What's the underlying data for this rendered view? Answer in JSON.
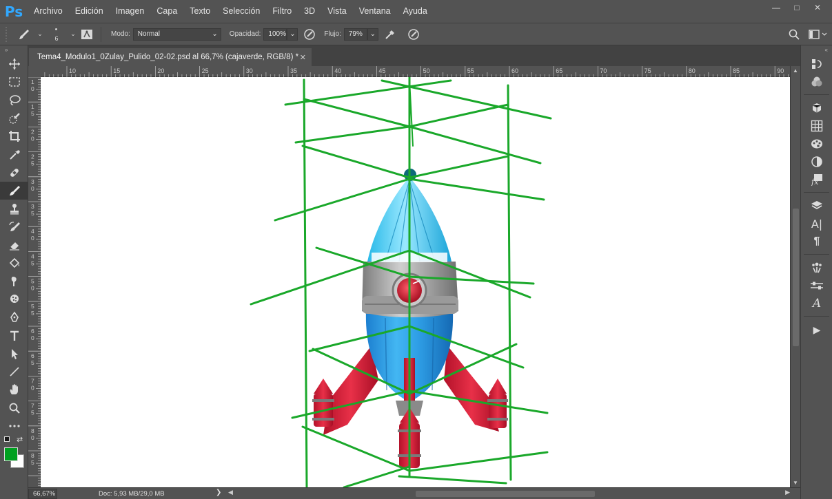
{
  "app": {
    "logo": "Ps"
  },
  "menu": [
    "Archivo",
    "Edición",
    "Imagen",
    "Capa",
    "Texto",
    "Selección",
    "Filtro",
    "3D",
    "Vista",
    "Ventana",
    "Ayuda"
  ],
  "window_controls": {
    "minimize": "—",
    "maximize": "□",
    "close": "✕"
  },
  "options": {
    "brush_size": "6",
    "mode_label": "Modo:",
    "mode_value": "Normal",
    "opacity_label": "Opacidad:",
    "opacity_value": "100%",
    "flow_label": "Flujo:",
    "flow_value": "79%"
  },
  "document": {
    "tab_title": "Tema4_Modulo1_0Zulay_Pulido_02-02.psd al 66,7% (cajaverde, RGB/8) *",
    "close": "✕"
  },
  "ruler": {
    "top_labels": [
      "10",
      "15",
      "20",
      "25",
      "30",
      "35",
      "40",
      "45",
      "50",
      "55",
      "60",
      "65",
      "70",
      "75",
      "80",
      "85",
      "90"
    ],
    "left_labels": [
      "1 0",
      "1 5",
      "2 0",
      "2 5",
      "3 0",
      "3 5",
      "4 0",
      "4 5",
      "5 0",
      "5 5",
      "6 0",
      "6 5",
      "7 0",
      "7 5",
      "8 0",
      "8 5"
    ]
  },
  "status": {
    "zoom": "66,67%",
    "doc_info": "Doc: 5,93 MB/29,0 MB",
    "arrow": "❯"
  },
  "colors": {
    "foreground": "#00a020",
    "background": "#ffffff",
    "guide_green": "#1aa82a",
    "ps_blue": "#31a8ff"
  },
  "right_dock_labels": {
    "character": "A|",
    "paragraph": "¶",
    "glyphs": "A",
    "actions": "▶"
  }
}
